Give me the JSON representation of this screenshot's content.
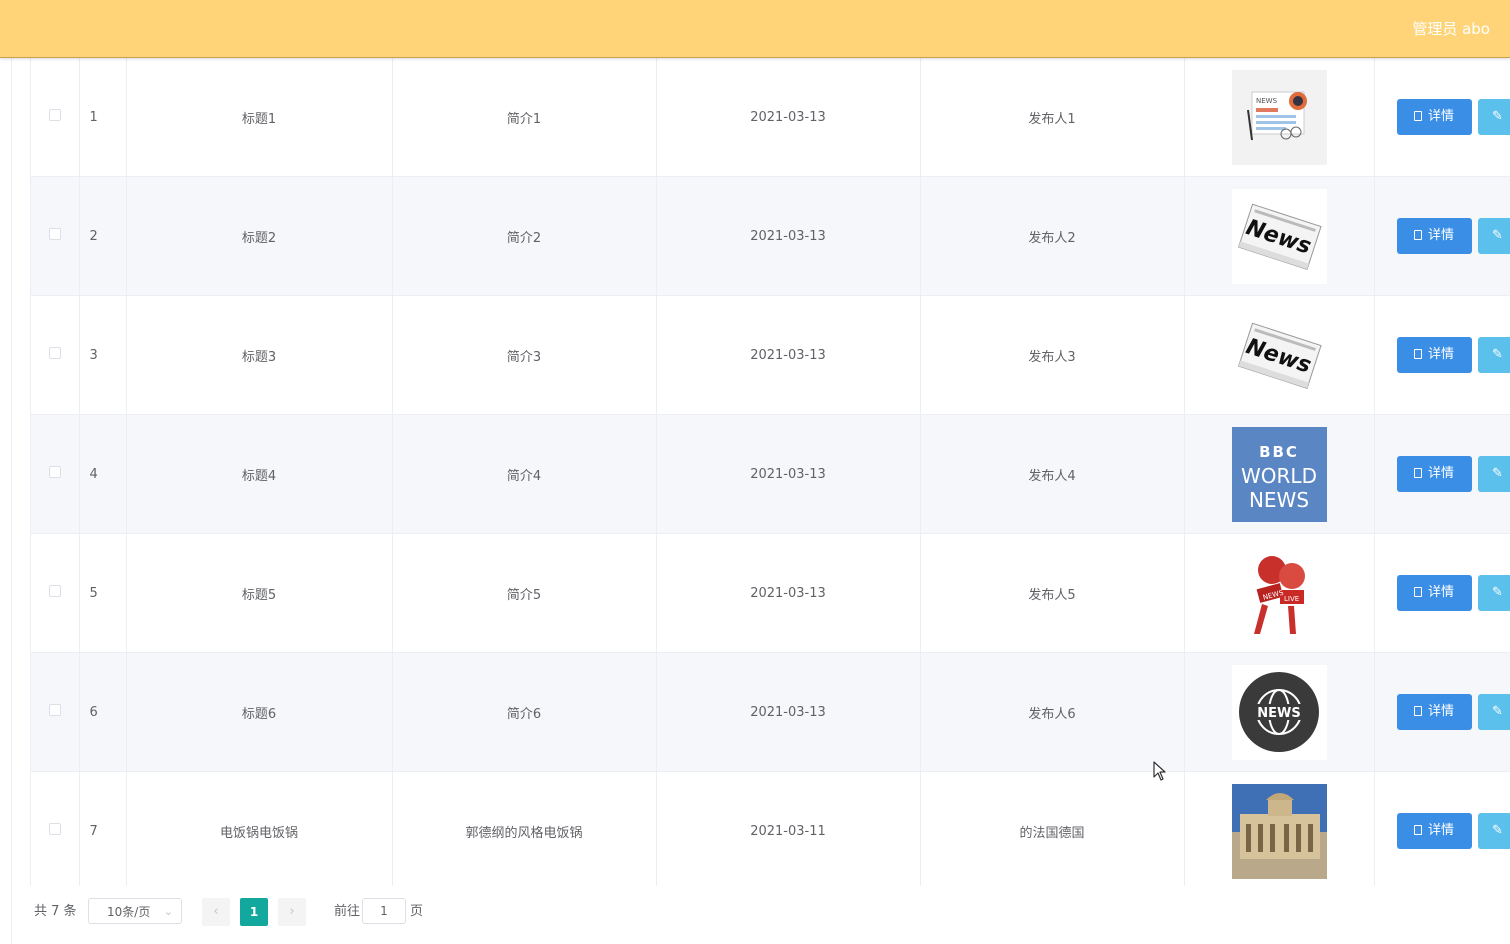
{
  "header": {
    "user_label": "管理员 abo"
  },
  "table": {
    "rows": [
      {
        "index": "1",
        "title": "标题1",
        "intro": "简介1",
        "date": "2021-03-13",
        "publisher": "发布人1",
        "image": "news-paper-illustration"
      },
      {
        "index": "2",
        "title": "标题2",
        "intro": "简介2",
        "date": "2021-03-13",
        "publisher": "发布人2",
        "image": "news-newspaper-black"
      },
      {
        "index": "3",
        "title": "标题3",
        "intro": "简介3",
        "date": "2021-03-13",
        "publisher": "发布人3",
        "image": "news-newspaper-black"
      },
      {
        "index": "4",
        "title": "标题4",
        "intro": "简介4",
        "date": "2021-03-13",
        "publisher": "发布人4",
        "image": "bbc-world-news"
      },
      {
        "index": "5",
        "title": "标题5",
        "intro": "简介5",
        "date": "2021-03-13",
        "publisher": "发布人5",
        "image": "news-microphones"
      },
      {
        "index": "6",
        "title": "标题6",
        "intro": "简介6",
        "date": "2021-03-13",
        "publisher": "发布人6",
        "image": "news-globe-badge"
      },
      {
        "index": "7",
        "title": "电饭锅电饭锅",
        "intro": "郭德纲的风格电饭锅",
        "date": "2021-03-11",
        "publisher": "的法国德国",
        "image": "building-photo"
      }
    ],
    "detail_label": "详情",
    "bbc_lines": [
      "BBC",
      "WORLD",
      "NEWS"
    ],
    "news_word": "News",
    "news_caps": "NEWS",
    "live_word": "LIVE"
  },
  "pagination": {
    "total": "共 7 条",
    "page_size": "10条/页",
    "current_page": "1",
    "goto_label": "前往",
    "goto_value": "1",
    "page_unit": "页"
  },
  "colors": {
    "header_bg": "#ffd478",
    "detail_button": "#3a8ee6",
    "edit_button": "#5bc0eb",
    "active_page": "#13a89e"
  }
}
